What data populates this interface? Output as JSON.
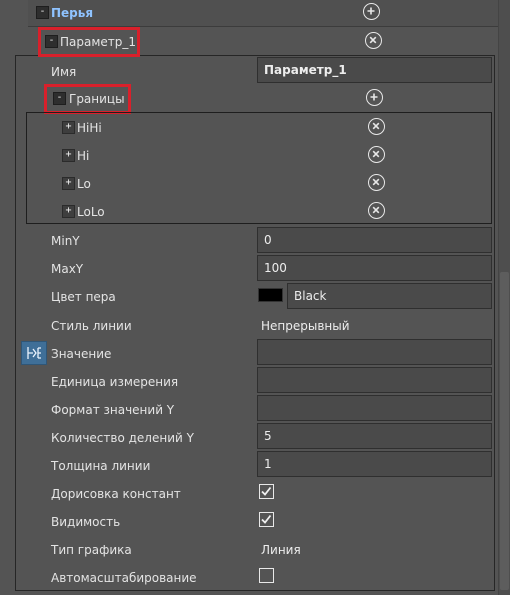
{
  "tree": {
    "root": {
      "label": "Перья",
      "expander": "-",
      "action_icon": "plus-circle-icon"
    },
    "param": {
      "label": "Параметр_1",
      "expander": "-",
      "action_icon": "close-circle-icon"
    },
    "name": {
      "label": "Имя",
      "value": "Параметр_1"
    },
    "bounds": {
      "label": "Границы",
      "expander": "-",
      "action_icon": "plus-circle-icon",
      "items": [
        {
          "label": "HiHi",
          "expander": "+"
        },
        {
          "label": "Hi",
          "expander": "+"
        },
        {
          "label": "Lo",
          "expander": "+"
        },
        {
          "label": "LoLo",
          "expander": "+"
        }
      ]
    }
  },
  "props": {
    "miny": {
      "label": "MinY",
      "value": "0"
    },
    "maxy": {
      "label": "MaxY",
      "value": "100"
    },
    "pen_color": {
      "label": "Цвет пера",
      "value": "Black",
      "swatch": "#000000"
    },
    "line_style": {
      "label": "Стиль линии",
      "value": "Непрерывный"
    },
    "value": {
      "label": "Значение",
      "value": "",
      "icon": "binding-icon"
    },
    "unit": {
      "label": "Единица измерения",
      "value": ""
    },
    "format": {
      "label": "Формат значений Y",
      "value": ""
    },
    "divisions": {
      "label": "Количество делений Y",
      "value": "5"
    },
    "thickness": {
      "label": "Толщина линии",
      "value": "1"
    },
    "draw_const": {
      "label": "Дорисовка констант",
      "checked": true
    },
    "visible": {
      "label": "Видимость",
      "checked": true
    },
    "chart_type": {
      "label": "Тип графика",
      "value": "Линия"
    },
    "autoscale": {
      "label": "Автомасштабирование",
      "checked": false
    }
  },
  "colors": {
    "background": "#545454",
    "accent_link": "#8fc3ff",
    "highlight": "#d9202b"
  }
}
